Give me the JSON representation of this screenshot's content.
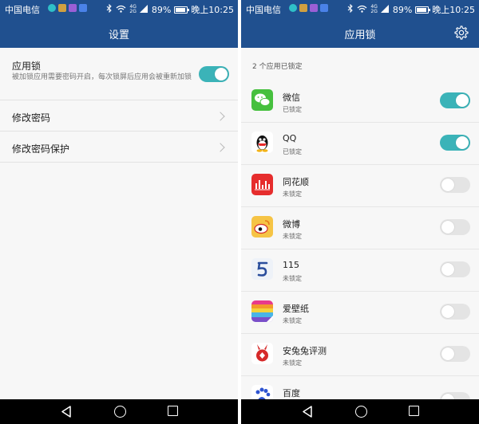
{
  "status_bar": {
    "carrier": "中国电信",
    "battery": "89%",
    "battery_level": 0.89,
    "time": "晚上10:25",
    "network_top": "4G",
    "network_bottom": "2G",
    "icons": [
      "notification-icon",
      "photo-icon",
      "app-icon",
      "message-icon",
      "bluetooth-icon",
      "wifi-icon",
      "signal-icon",
      "battery-icon"
    ]
  },
  "settings": {
    "title": "设置",
    "app_lock": {
      "title": "应用锁",
      "description": "被加锁应用需要密码开启，每次锁屏后应用会被重新加锁",
      "enabled": true
    },
    "change_password": "修改密码",
    "change_password_protection": "修改密码保护"
  },
  "app_lock": {
    "title": "应用锁",
    "count_text": "2 个应用已锁定",
    "apps": [
      {
        "name": "微信",
        "status": "已锁定",
        "locked": true,
        "icon": "wechat-icon"
      },
      {
        "name": "QQ",
        "status": "已锁定",
        "locked": true,
        "icon": "qq-icon"
      },
      {
        "name": "同花顺",
        "status": "未锁定",
        "locked": false,
        "icon": "tonghuashun-icon"
      },
      {
        "name": "微博",
        "status": "未锁定",
        "locked": false,
        "icon": "weibo-icon"
      },
      {
        "name": "115",
        "status": "未锁定",
        "locked": false,
        "icon": "115-icon"
      },
      {
        "name": "爱壁纸",
        "status": "未锁定",
        "locked": false,
        "icon": "wallpaper-icon"
      },
      {
        "name": "安兔兔评测",
        "status": "未锁定",
        "locked": false,
        "icon": "antutu-icon"
      },
      {
        "name": "百度",
        "status": "",
        "locked": false,
        "icon": "baidu-icon"
      }
    ]
  },
  "colors": {
    "header": "#20508f",
    "toggle_on": "#3bb3b8",
    "toggle_off": "#e4e4e4"
  }
}
